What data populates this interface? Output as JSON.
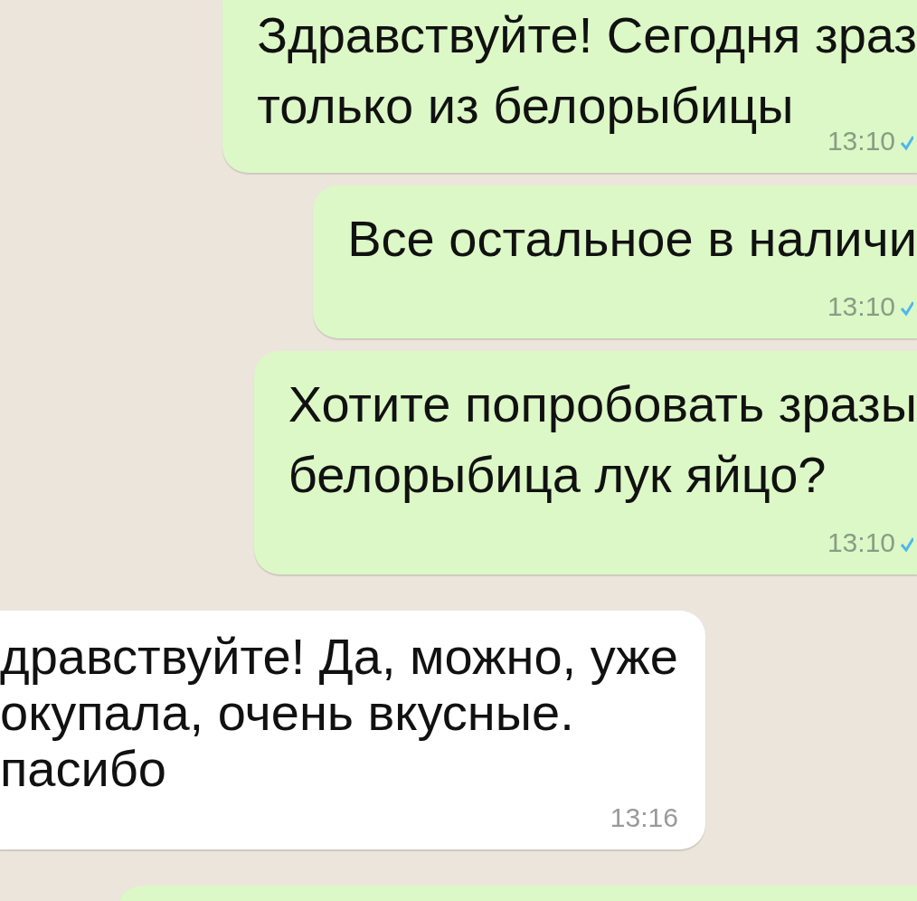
{
  "messages": [
    {
      "kind": "outgoing",
      "text": "Здравствуйте! Сегодня зраз\nтолько из белорыбицы",
      "time": "13:10",
      "read": true
    },
    {
      "kind": "outgoing",
      "text": "Все остальное в наличи",
      "time": "13:10",
      "read": true
    },
    {
      "kind": "outgoing",
      "text": "Хотите попробовать зразы\nбелорыбица лук яйцо?",
      "time": "13:10",
      "read": true
    },
    {
      "kind": "incoming",
      "text": "дравствуйте! Да, можно, уже\nокупала, очень вкусные.\nпасибо",
      "time": "13:16"
    },
    {
      "kind": "outgoing"
    }
  ]
}
